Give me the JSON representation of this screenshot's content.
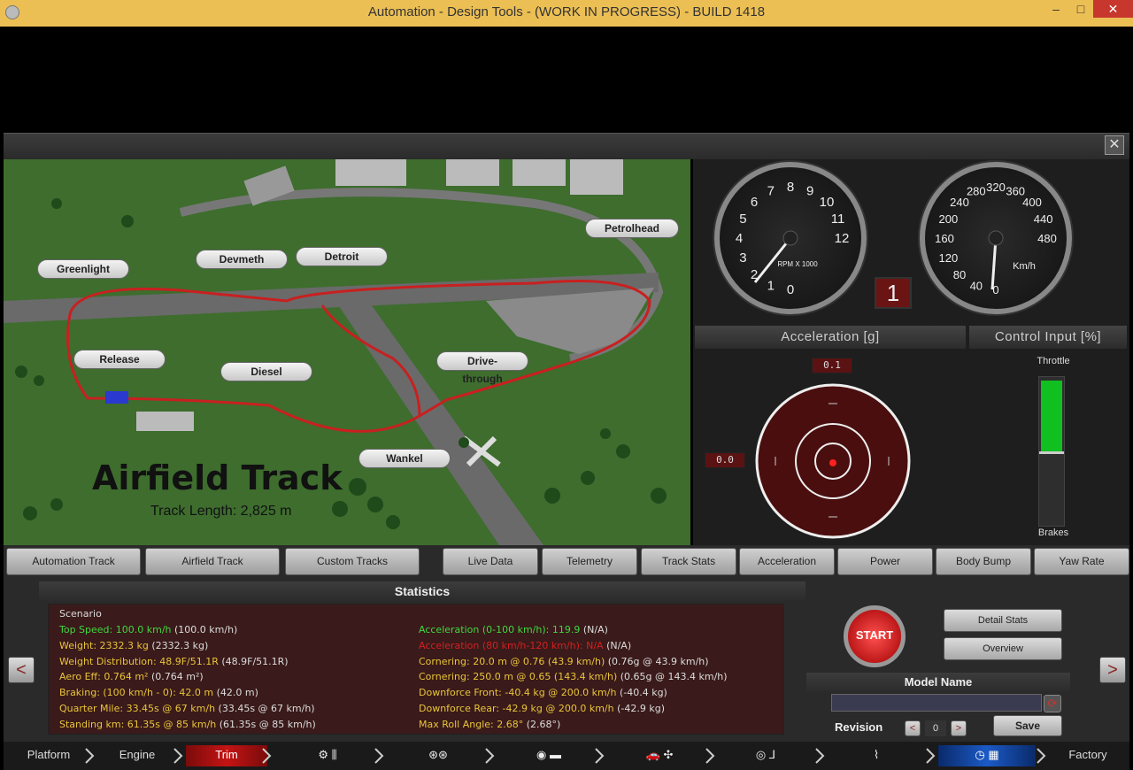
{
  "window": {
    "title": "Automation - Design Tools - (WORK IN PROGRESS) - BUILD 1418",
    "min": "–",
    "max": "□",
    "close": "✕"
  },
  "panel": {
    "close": "✕"
  },
  "map": {
    "title": "Airfield Track",
    "subtitle": "Track Length: 2,825 m",
    "callouts": [
      "Greenlight",
      "Devmeth",
      "Detroit",
      "Petrolhead",
      "Release",
      "Diesel",
      "Drive-through",
      "Wankel"
    ]
  },
  "gauges": {
    "rpm_label": "RPM X 1000",
    "rpm_ticks": [
      "0",
      "1",
      "2",
      "3",
      "4",
      "5",
      "6",
      "7",
      "8",
      "9",
      "10",
      "11",
      "12"
    ],
    "speed_label": "Km/h",
    "speed_ticks": [
      "0",
      "40",
      "80",
      "120",
      "160",
      "200",
      "240",
      "280",
      "320",
      "360",
      "400",
      "440",
      "480"
    ],
    "gear": "1"
  },
  "acceleration": {
    "header": "Acceleration [g]",
    "long": "0.1",
    "lat": "0.0"
  },
  "control": {
    "header": "Control Input [%]",
    "throttle": "Throttle",
    "brakes": "Brakes",
    "throttle_level": 0.95
  },
  "track_tabs": [
    "Automation Track",
    "Airfield Track",
    "Custom Tracks"
  ],
  "data_tabs": [
    "Live Data",
    "Telemetry",
    "Track Stats",
    "Acceleration",
    "Power",
    "Body Bump",
    "Yaw Rate"
  ],
  "statistics": {
    "header": "Statistics",
    "scenario": "Scenario",
    "left": [
      {
        "main": "Top Speed: 100.0 km/h",
        "extra": " (100.0 km/h)",
        "color": "g"
      },
      {
        "main": "Weight: 2332.3 kg",
        "extra": " (2332.3 kg)",
        "color": "y"
      },
      {
        "main": "Weight Distribution: 48.9F/51.1R",
        "extra": " (48.9F/51.1R)",
        "color": "y"
      },
      {
        "main": "Aero Eff: 0.764 m²",
        "extra": " (0.764 m²)",
        "color": "y"
      },
      {
        "main": "Braking: (100 km/h - 0): 42.0 m",
        "extra": " (42.0 m)",
        "color": "y"
      },
      {
        "main": "Quarter Mile: 33.45s @ 67 km/h",
        "extra": " (33.45s @ 67 km/h)",
        "color": "y"
      },
      {
        "main": "Standing km: 61.35s @ 85 km/h",
        "extra": " (61.35s @ 85 km/h)",
        "color": "y"
      }
    ],
    "right": [
      {
        "main": "Acceleration (0-100 km/h): 119.9",
        "extra": " (N/A)",
        "color": "g"
      },
      {
        "main": "Acceleration (80 km/h-120 km/h): N/A",
        "extra": " (N/A)",
        "color": "r"
      },
      {
        "main": "Cornering: 20.0 m @ 0.76 (43.9 km/h)",
        "extra": " (0.76g @ 43.9 km/h)",
        "color": "y"
      },
      {
        "main": "Cornering: 250.0 m @ 0.65 (143.4 km/h)",
        "extra": " (0.65g @ 143.4 km/h)",
        "color": "y"
      },
      {
        "main": "Downforce Front: -40.4 kg @ 200.0 km/h",
        "extra": " (-40.4 kg)",
        "color": "y"
      },
      {
        "main": "Downforce Rear: -42.9 kg @ 200.0 km/h",
        "extra": " (-42.9 kg)",
        "color": "y"
      },
      {
        "main": "Max Roll Angle: 2.68°",
        "extra": " (2.68°)",
        "color": "y"
      }
    ]
  },
  "actions": {
    "start": "START",
    "detail_stats": "Detail Stats",
    "overview": "Overview",
    "model_name": "Model Name",
    "model_value": "",
    "revision": "Revision",
    "revision_value": "0",
    "save": "Save",
    "prev": "<",
    "next": ">"
  },
  "nav": {
    "platform": "Platform",
    "engine": "Engine",
    "trim": "Trim",
    "factory": "Factory"
  }
}
